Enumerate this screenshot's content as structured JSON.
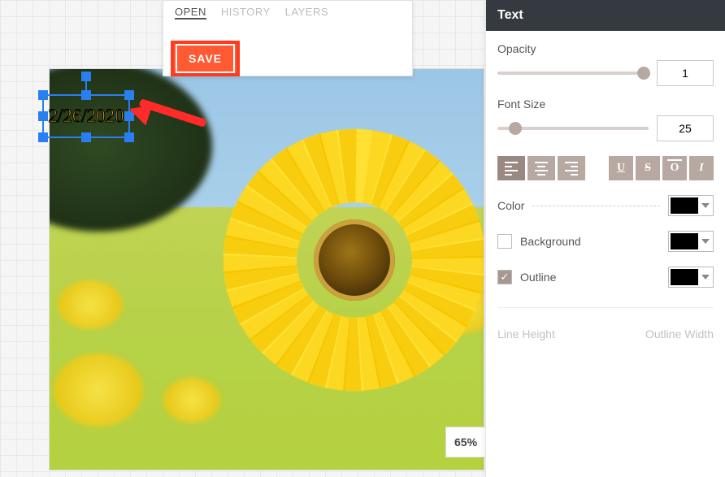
{
  "top_panel": {
    "tabs": {
      "open": "OPEN",
      "history": "HISTORY",
      "layers": "LAYERS"
    },
    "save_label": "SAVE"
  },
  "canvas": {
    "date_text": "2/26/2020"
  },
  "zoom": {
    "level": "65%"
  },
  "sidebar": {
    "title": "Text",
    "opacity": {
      "label": "Opacity",
      "value": "1"
    },
    "font_size": {
      "label": "Font Size",
      "value": "25"
    },
    "style": {
      "underline": "U",
      "strike": "S",
      "overline": "O",
      "italic": "I"
    },
    "color": {
      "label": "Color",
      "swatch": "#000000"
    },
    "background": {
      "label": "Background",
      "checked": false,
      "swatch": "#000000"
    },
    "outline": {
      "label": "Outline",
      "checked": true,
      "swatch": "#000000"
    },
    "line_height": {
      "label": "Line Height"
    },
    "outline_width": {
      "label": "Outline Width"
    }
  }
}
